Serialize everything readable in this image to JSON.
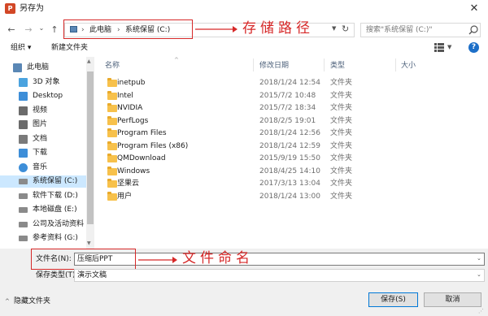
{
  "window": {
    "app_icon_text": "P",
    "title": "另存为",
    "close_glyph": "✕"
  },
  "address_bar": {
    "back_glyph": "←",
    "forward_glyph": "→",
    "history_glyph": "⌄",
    "up_glyph": "↑",
    "crumbs": [
      "此电脑",
      "系统保留 (C:)"
    ],
    "separator": "›",
    "dropdown_glyph": "▼",
    "refresh_glyph": "↻"
  },
  "search": {
    "placeholder": "搜索\"系统保留 (C:)\""
  },
  "annotations": {
    "path_label": "存储路径",
    "name_label": "文件命名",
    "color": "#d62828"
  },
  "toolbar": {
    "organize": "组织 ▾",
    "new_folder": "新建文件夹",
    "view_dropdown": "▼",
    "help": "?"
  },
  "nav": {
    "scroll_up": "▲",
    "scroll_down": "▼",
    "items": [
      {
        "label": "此电脑",
        "icon": "computer-icon",
        "level": 0,
        "selected": false
      },
      {
        "label": "3D 对象",
        "icon": "cube-icon",
        "level": 1,
        "selected": false
      },
      {
        "label": "Desktop",
        "icon": "desktop-icon",
        "level": 1,
        "selected": false
      },
      {
        "label": "视频",
        "icon": "video-icon",
        "level": 1,
        "selected": false
      },
      {
        "label": "图片",
        "icon": "picture-icon",
        "level": 1,
        "selected": false
      },
      {
        "label": "文档",
        "icon": "document-icon",
        "level": 1,
        "selected": false
      },
      {
        "label": "下载",
        "icon": "download-icon",
        "level": 1,
        "selected": false
      },
      {
        "label": "音乐",
        "icon": "music-icon",
        "level": 1,
        "selected": false
      },
      {
        "label": "系统保留 (C:)",
        "icon": "drive-icon",
        "level": 1,
        "selected": true
      },
      {
        "label": "软件下载 (D:)",
        "icon": "drive-icon",
        "level": 1,
        "selected": false
      },
      {
        "label": "本地磁盘 (E:)",
        "icon": "drive-icon",
        "level": 1,
        "selected": false
      },
      {
        "label": "公司及活动资料",
        "icon": "drive-icon",
        "level": 1,
        "selected": false
      },
      {
        "label": "参考资料 (G:)",
        "icon": "drive-icon",
        "level": 1,
        "selected": false
      }
    ]
  },
  "columns": {
    "name": "名称",
    "date": "修改日期",
    "type": "类型",
    "size": "大小",
    "sort_glyph": "^"
  },
  "files": [
    {
      "name": "inetpub",
      "date": "2018/1/24 12:54",
      "type": "文件夹"
    },
    {
      "name": "Intel",
      "date": "2015/7/2 10:48",
      "type": "文件夹"
    },
    {
      "name": "NVIDIA",
      "date": "2015/7/2 18:34",
      "type": "文件夹"
    },
    {
      "name": "PerfLogs",
      "date": "2018/2/5 19:01",
      "type": "文件夹"
    },
    {
      "name": "Program Files",
      "date": "2018/1/24 12:56",
      "type": "文件夹"
    },
    {
      "name": "Program Files (x86)",
      "date": "2018/1/24 12:59",
      "type": "文件夹"
    },
    {
      "name": "QMDownload",
      "date": "2015/9/19 15:50",
      "type": "文件夹"
    },
    {
      "name": "Windows",
      "date": "2018/4/25 14:10",
      "type": "文件夹"
    },
    {
      "name": "坚果云",
      "date": "2017/3/13 13:04",
      "type": "文件夹"
    },
    {
      "name": "用户",
      "date": "2018/1/24 13:00",
      "type": "文件夹"
    }
  ],
  "save_form": {
    "filename_label": "文件名(N):",
    "filename_value": "压缩后PPT",
    "filetype_label": "保存类型(T):",
    "filetype_value": "演示文稿",
    "dropdown_glyph": "⌄"
  },
  "footer": {
    "hide_folders_glyph": "^",
    "hide_folders": "隐藏文件夹",
    "save": "保存(S)",
    "cancel": "取消",
    "grip": "⋰"
  }
}
